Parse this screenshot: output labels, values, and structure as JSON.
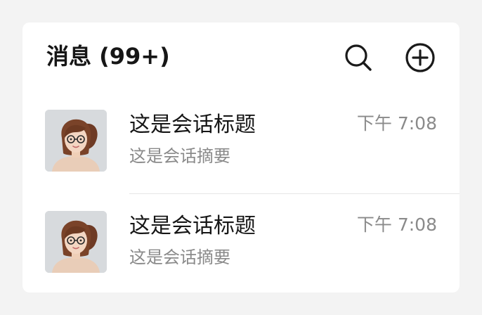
{
  "header": {
    "title": "消息 (99+)",
    "search_icon": "search-icon",
    "add_icon": "add-circle-icon"
  },
  "conversations": [
    {
      "title": "这是会话标题",
      "summary": "这是会话摘要",
      "time": "下午 7:08",
      "avatar": "girl-with-glasses-avatar"
    },
    {
      "title": "这是会话标题",
      "summary": "这是会话摘要",
      "time": "下午 7:08",
      "avatar": "girl-with-glasses-avatar"
    }
  ]
}
